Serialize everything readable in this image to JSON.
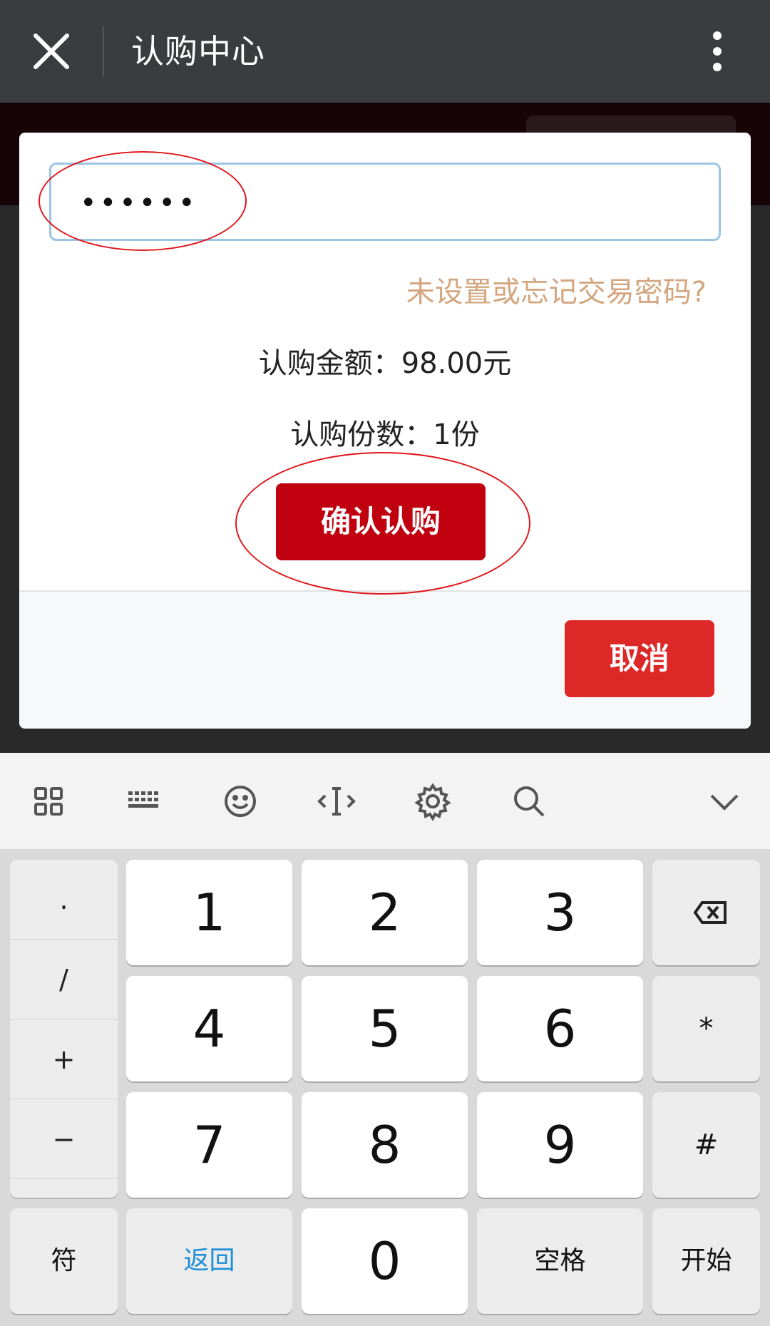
{
  "app_bar": {
    "title": "认购中心",
    "close_icon": "close-icon",
    "more_icon": "more-vertical-icon"
  },
  "dialog": {
    "password_value": "••••••",
    "forgot_link": "未设置或忘记交易密码?",
    "amount_line": "认购金额：98.00元",
    "shares_line": "认购份数：1份",
    "confirm_button": "确认认购",
    "cancel_button": "取消"
  },
  "keyboard": {
    "toolbar_icons": [
      "grid-apps-icon",
      "keyboard-icon",
      "emoji-icon",
      "cursor-icon",
      "settings-icon",
      "search-icon",
      "collapse-icon"
    ],
    "symbols": [
      ".",
      "/",
      "+",
      "−"
    ],
    "keys": {
      "k1": "1",
      "k2": "2",
      "k3": "3",
      "k4": "4",
      "k5": "5",
      "k6": "6",
      "k7": "7",
      "k8": "8",
      "k9": "9",
      "k0": "0",
      "star": "*",
      "hash": "#",
      "symbol": "符",
      "back": "返回",
      "space": "空格",
      "start": "开始"
    },
    "colors": {
      "confirm": "#c0000f",
      "cancel": "#dc2928",
      "link": "#d3a67f",
      "back_key": "#1d8fd8"
    }
  }
}
